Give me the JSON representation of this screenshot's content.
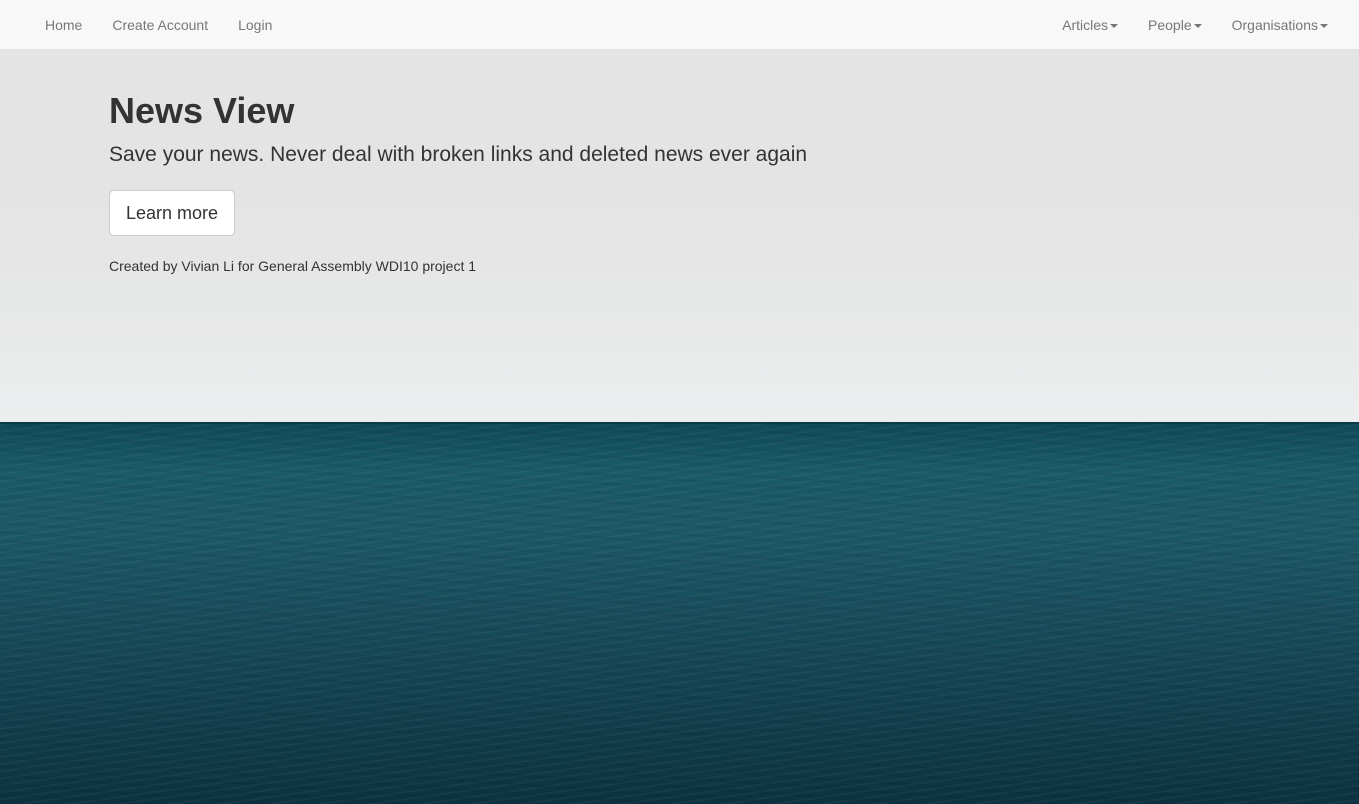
{
  "nav": {
    "left": [
      {
        "label": "Home"
      },
      {
        "label": "Create Account"
      },
      {
        "label": "Login"
      }
    ],
    "right": [
      {
        "label": "Articles"
      },
      {
        "label": "People"
      },
      {
        "label": "Organisations"
      }
    ]
  },
  "hero": {
    "title": "News View",
    "subtitle": "Save your news. Never deal with broken links and deleted news ever again",
    "button_label": "Learn more",
    "credit": "Created by Vivian Li for General Assembly WDI10 project 1"
  },
  "colors": {
    "navbar_bg": "#f8f8f8",
    "nav_text": "#777777",
    "text": "#333333",
    "sea": "#1c5766"
  }
}
